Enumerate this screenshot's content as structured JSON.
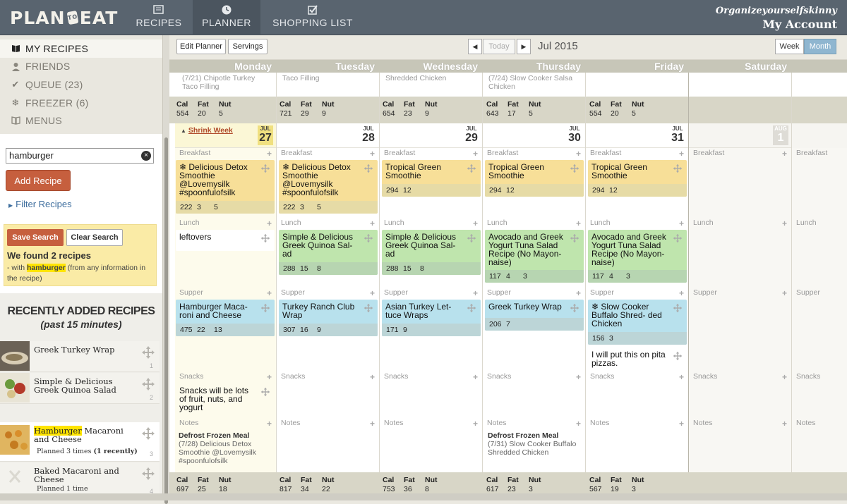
{
  "app": {
    "logo_text_1": "PLAN",
    "logo_text_to": "TO",
    "logo_text_2": "EAT",
    "nav": [
      {
        "label": "RECIPES",
        "icon": "recipes-icon",
        "active": false
      },
      {
        "label": "PLANNER",
        "icon": "clock-icon",
        "active": true
      },
      {
        "label": "SHOPPING LIST",
        "icon": "checklist-icon",
        "active": false
      }
    ],
    "account": {
      "username": "Organizeyourselfskinny",
      "link": "My Account"
    }
  },
  "sidebar": {
    "items": [
      {
        "label": "MY RECIPES",
        "icon": "book-icon",
        "active": true
      },
      {
        "label": "FRIENDS",
        "icon": "person-icon",
        "active": false
      },
      {
        "label": "QUEUE (23)",
        "icon": "check-icon",
        "active": false
      },
      {
        "label": "FREEZER (6)",
        "icon": "snowflake-icon",
        "active": false
      },
      {
        "label": "MENUS",
        "icon": "menu-book-icon",
        "active": false
      }
    ],
    "search_value": "hamburger",
    "add_recipe": "Add Recipe",
    "filter_recipes": "Filter Recipes",
    "save_search": "Save Search",
    "clear_search": "Clear Search",
    "found_text": "We found 2 recipes",
    "found_prefix": "- with ",
    "found_term": "hamburger",
    "found_suffix": " (from any information in the recipe)",
    "recent_title": "RECENTLY ADDED RECIPES",
    "recent_subtitle": "(past 15 minutes)",
    "recent": [
      {
        "title": "Greek Turkey Wrap",
        "sub": "",
        "num": "1"
      },
      {
        "title": "Simple & Delicious Greek Quinoa Salad",
        "sub": "",
        "num": "2"
      },
      {
        "title_hl": "Hamburger",
        "title": " Macaroni and Cheese",
        "sub": "Planned 3 times",
        "sub_bold": "(1 recently)",
        "num": "3"
      },
      {
        "title": "Baked Macaroni and Cheese",
        "sub": "Planned 1 time",
        "num": "4"
      }
    ]
  },
  "toolbar": {
    "edit_planner": "Edit Planner",
    "servings": "Servings",
    "today": "Today",
    "month_label": "Jul 2015",
    "week": "Week",
    "month": "Month"
  },
  "days": [
    "Monday",
    "Tuesday",
    "Wednesday",
    "Thursday",
    "Friday",
    "Saturday"
  ],
  "prev_week_meals": [
    "(7/21) Chipotle Turkey Taco Filling",
    "Taco Filling",
    "Shredded Chicken",
    "(7/24) Slow Cooker Salsa Chicken",
    "",
    "",
    ""
  ],
  "nut_header": {
    "cal": "Cal",
    "fat": "Fat",
    "nut": "Nut"
  },
  "prev_week_totals": [
    {
      "cal": "554",
      "fat": "20",
      "nut": "5"
    },
    {
      "cal": "721",
      "fat": "29",
      "nut": "9"
    },
    {
      "cal": "654",
      "fat": "23",
      "nut": "9"
    },
    {
      "cal": "643",
      "fat": "17",
      "nut": "5"
    },
    {
      "cal": "554",
      "fat": "20",
      "nut": "5"
    }
  ],
  "shrink_week": "Shrink Week",
  "week_dates": [
    {
      "month": "JUL",
      "day": "27"
    },
    {
      "month": "JUL",
      "day": "28"
    },
    {
      "month": "JUL",
      "day": "29"
    },
    {
      "month": "JUL",
      "day": "30"
    },
    {
      "month": "JUL",
      "day": "31"
    },
    {
      "month": "AUG",
      "day": "1"
    }
  ],
  "sections": {
    "breakfast": "Breakfast",
    "lunch": "Lunch",
    "supper": "Supper",
    "snacks": "Snacks",
    "notes": "Notes"
  },
  "meals": {
    "breakfast": [
      {
        "title": "Delicious Detox Smoothie @Lovemysilk #spoonfulofsilk",
        "cal": "222",
        "fat": "3",
        "nut": "5",
        "frozen": true
      },
      {
        "title": "Delicious Detox Smoothie @Lovemysilk #spoonfulofsilk",
        "cal": "222",
        "fat": "3",
        "nut": "5",
        "frozen": true
      },
      {
        "title": "Tropical Green Smoothie",
        "cal": "294",
        "fat": "12",
        "nut": ""
      },
      {
        "title": "Tropical Green Smoothie",
        "cal": "294",
        "fat": "12",
        "nut": ""
      },
      {
        "title": "Tropical Green Smoothie",
        "cal": "294",
        "fat": "12",
        "nut": ""
      }
    ],
    "lunch": [
      {
        "title": "leftovers"
      },
      {
        "title": "Simple & Delicious Greek Quinoa Sal- ad",
        "cal": "288",
        "fat": "15",
        "nut": "8"
      },
      {
        "title": "Simple & Delicious Greek Quinoa Sal- ad",
        "cal": "288",
        "fat": "15",
        "nut": "8"
      },
      {
        "title": "Avocado and Greek Yogurt Tuna Salad Recipe (No Mayon- naise)",
        "cal": "117",
        "fat": "4",
        "nut": "3"
      },
      {
        "title": "Avocado and Greek Yogurt Tuna Salad Recipe (No Mayon- naise)",
        "cal": "117",
        "fat": "4",
        "nut": "3"
      }
    ],
    "supper": [
      {
        "title": "Hamburger Maca- roni and Cheese",
        "cal": "475",
        "fat": "22",
        "nut": "13"
      },
      {
        "title": "Turkey Ranch Club Wrap",
        "cal": "307",
        "fat": "16",
        "nut": "9"
      },
      {
        "title": "Asian Turkey Let- tuce Wraps",
        "cal": "171",
        "fat": "9",
        "nut": ""
      },
      {
        "title": "Greek Turkey Wrap",
        "cal": "206",
        "fat": "7",
        "nut": ""
      },
      {
        "title": "Slow Cooker Buffalo Shred- ded Chicken",
        "cal": "156",
        "fat": "3",
        "nut": "",
        "frozen": true
      }
    ],
    "supper_note_fri": "I will put this on pita pizzas.",
    "snack_mon": "Snacks will be lots of fruit, nuts, and yogurt"
  },
  "notes": [
    {
      "title": "Defrost Frozen Meal",
      "text": "(7/28) Delicious Detox Smoothie @Lovemysilk #spoonfulofsilk"
    },
    {
      "title": "",
      "text": ""
    },
    {
      "title": "",
      "text": ""
    },
    {
      "title": "Defrost Frozen Meal",
      "text": "(7/31) Slow Cooker Buffalo Shredded Chicken"
    },
    {
      "title": "",
      "text": ""
    }
  ],
  "week_totals": [
    {
      "cal": "697",
      "fat": "25",
      "nut": "18"
    },
    {
      "cal": "817",
      "fat": "34",
      "nut": "22"
    },
    {
      "cal": "753",
      "fat": "36",
      "nut": "8"
    },
    {
      "cal": "617",
      "fat": "23",
      "nut": "3"
    },
    {
      "cal": "567",
      "fat": "19",
      "nut": "3"
    }
  ]
}
